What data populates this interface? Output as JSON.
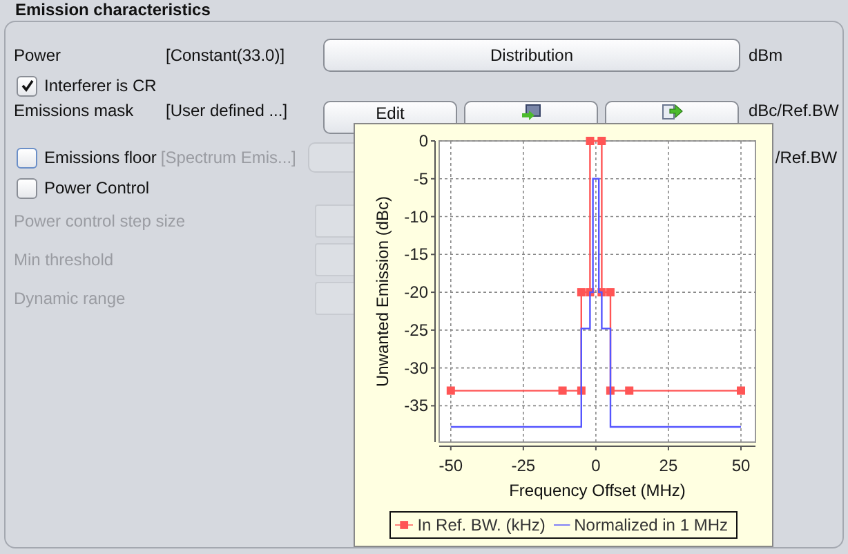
{
  "title": "Emission characteristics",
  "rows": [
    {
      "kind": "value",
      "label": "Power",
      "value": "[Constant(33.0)]",
      "button": "Distribution",
      "unit": "dBm"
    },
    {
      "kind": "checkbox",
      "label": "Interferer is CR",
      "checked": true
    },
    {
      "kind": "mask",
      "label": "Emissions mask",
      "value": "[User defined ...]",
      "button": "Edit",
      "unit": "dBc/Ref.BW"
    },
    {
      "kind": "floor",
      "label": "Emissions floor",
      "checked": false,
      "value": "[Spectrum Emis...]",
      "unit": "/Ref.BW"
    },
    {
      "kind": "checkbox",
      "label": "Power Control",
      "checked": false
    },
    {
      "kind": "field",
      "label": "Power control step size",
      "disabled": true
    },
    {
      "kind": "field",
      "label": "Min threshold",
      "disabled": true
    },
    {
      "kind": "field",
      "label": "Dynamic range",
      "disabled": true
    }
  ],
  "popup": {
    "chart_data": {
      "type": "line",
      "grid": true,
      "xlabel": "Frequency Offset (MHz)",
      "ylabel": "Unwanted Emission (dBc)",
      "xlim": [
        -54,
        55
      ],
      "ylim": [
        -39.8,
        0
      ],
      "xticks": [
        -50,
        -25,
        0,
        25,
        50
      ],
      "yticks": [
        0,
        -5,
        -10,
        -15,
        -20,
        -25,
        -30,
        -35
      ],
      "series": [
        {
          "name": "In Ref. BW. (kHz)",
          "color": "#ff5555",
          "marker": "square",
          "x": [
            -50,
            -11.5,
            -5,
            -5,
            -2,
            -2,
            2,
            2,
            5,
            5,
            11.5,
            50
          ],
          "values": [
            -33,
            -33,
            -33,
            -20,
            -20,
            0,
            0,
            -20,
            -20,
            -33,
            -33,
            -33
          ]
        },
        {
          "name": "Normalized in 1 MHz",
          "color": "#5555ff",
          "marker": "none",
          "x": [
            -50,
            -5,
            -5,
            -2,
            -2,
            -1,
            -1,
            1,
            1,
            2,
            2,
            5,
            5,
            50
          ],
          "values": [
            -37.8,
            -37.8,
            -24.8,
            -24.8,
            -20,
            -20,
            -5,
            -5,
            -20,
            -20,
            -24.8,
            -24.8,
            -37.8,
            -37.8
          ]
        }
      ]
    }
  }
}
